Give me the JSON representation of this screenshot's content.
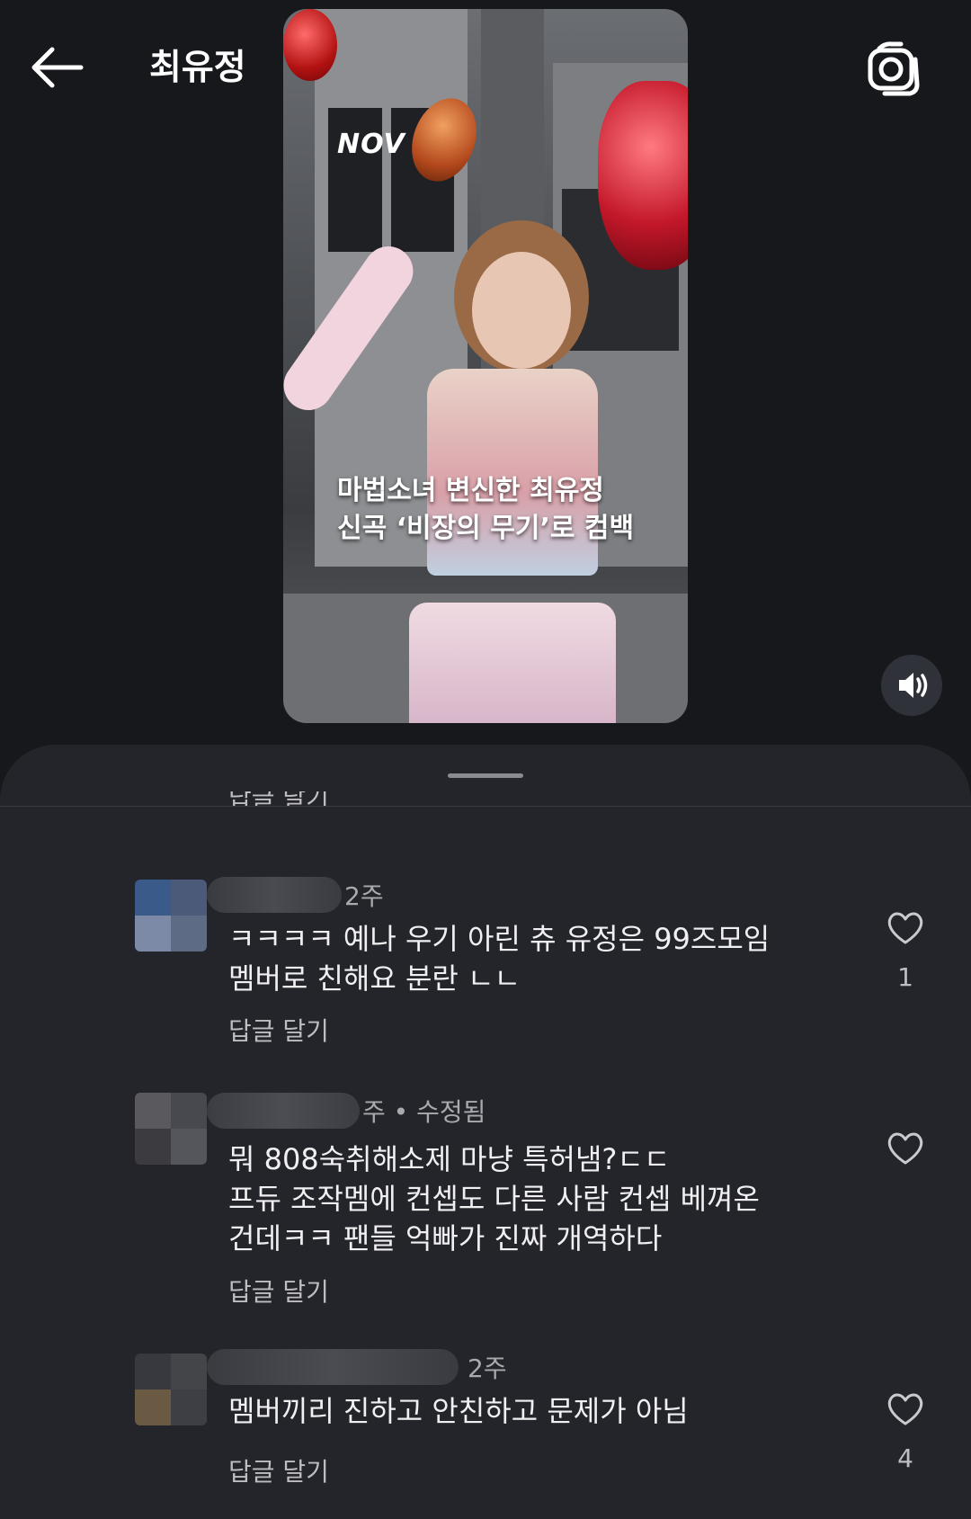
{
  "header": {
    "title": "최유정",
    "back_icon": "arrow-left-icon",
    "camera_icon": "camera-icon"
  },
  "video": {
    "logo": "NOV",
    "caption_line1": "마법소녀 변신한 최유정",
    "caption_line2": "신곡 ‘비장의 무기’로 컴백",
    "sound_icon": "speaker-icon"
  },
  "comments_sheet": {
    "cut_reply_label": "답글 달기",
    "comments": [
      {
        "meta": "2주",
        "lines": [
          "ㅋㅋㅋㅋ 예나 우기 아린 츄 유정은 99즈모임",
          "멤버로 친해요 분란 ㄴㄴ"
        ],
        "reply_label": "답글 달기",
        "likes": "1"
      },
      {
        "meta": "주 • 수정됨",
        "lines": [
          "뭐 808숙취해소제 마냥 특허냄?ㄷㄷ",
          "프듀 조작멤에 컨셉도 다른 사람 컨셉 베껴온",
          "건데ㅋㅋ 팬들 억빠가 진짜 개역하다"
        ],
        "reply_label": "답글 달기",
        "likes": ""
      },
      {
        "meta": "2주",
        "lines": [
          "멤버끼리 진하고 안친하고 문제가 아님"
        ],
        "reply_label": "답글 달기",
        "likes": "4"
      }
    ]
  },
  "colors": {
    "background": "#17181c",
    "sheet": "#24252b",
    "text_primary": "#f0f0f2",
    "text_secondary": "#a9aaae"
  }
}
